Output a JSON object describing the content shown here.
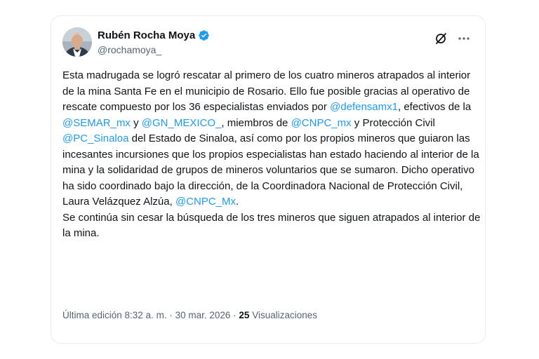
{
  "author": {
    "display_name": "Rubén Rocha Moya",
    "handle": "@rochamoya_",
    "verified": true
  },
  "header_actions": {
    "grok_icon": "grok-icon",
    "more_icon": "more-icon"
  },
  "tweet": {
    "p1": "Esta madrugada se logró rescatar al primero de los cuatro mineros atrapados al interior de la mina Santa Fe en el municipio de Rosario. Ello fue posible gracias al operativo de rescate compuesto por los 36 especialistas enviados por ",
    "m1": "@defensamx1",
    "p2": ", efectivos de la ",
    "m2": "@SEMAR_mx",
    "p3": " y ",
    "m3": "@GN_MEXICO_",
    "p4": ", miembros de ",
    "m4": "@CNPC_mx",
    "p5": " y Protección Civil ",
    "m5": "@PC_Sinaloa",
    "p6": " del Estado de Sinaloa, así como por los propios mineros que guiaron las incesantes incursiones que los propios especialistas han estado haciendo al interior de la mina y la solidaridad de grupos de mineros voluntarios que se sumaron. Dicho operativo ha sido coordinado bajo la dirección, de la Coordinadora Nacional de Protección Civil, Laura Velázquez Alzúa, ",
    "m6": "@CNPC_Mx",
    "p7": ".",
    "p8": "Se continúa sin cesar la búsqueda de los tres mineros que siguen atrapados al interior de la mina."
  },
  "meta": {
    "edited_label": "Última edición 8:32 a. m.",
    "separator": " · ",
    "date": "30 mar. 2026",
    "views_count": "25",
    "views_label": "Visualizaciones"
  },
  "colors": {
    "link": "#1d9bf0",
    "verified_badge": "#1d9bf0",
    "secondary_text": "#536471",
    "border": "#e6ecf0"
  }
}
